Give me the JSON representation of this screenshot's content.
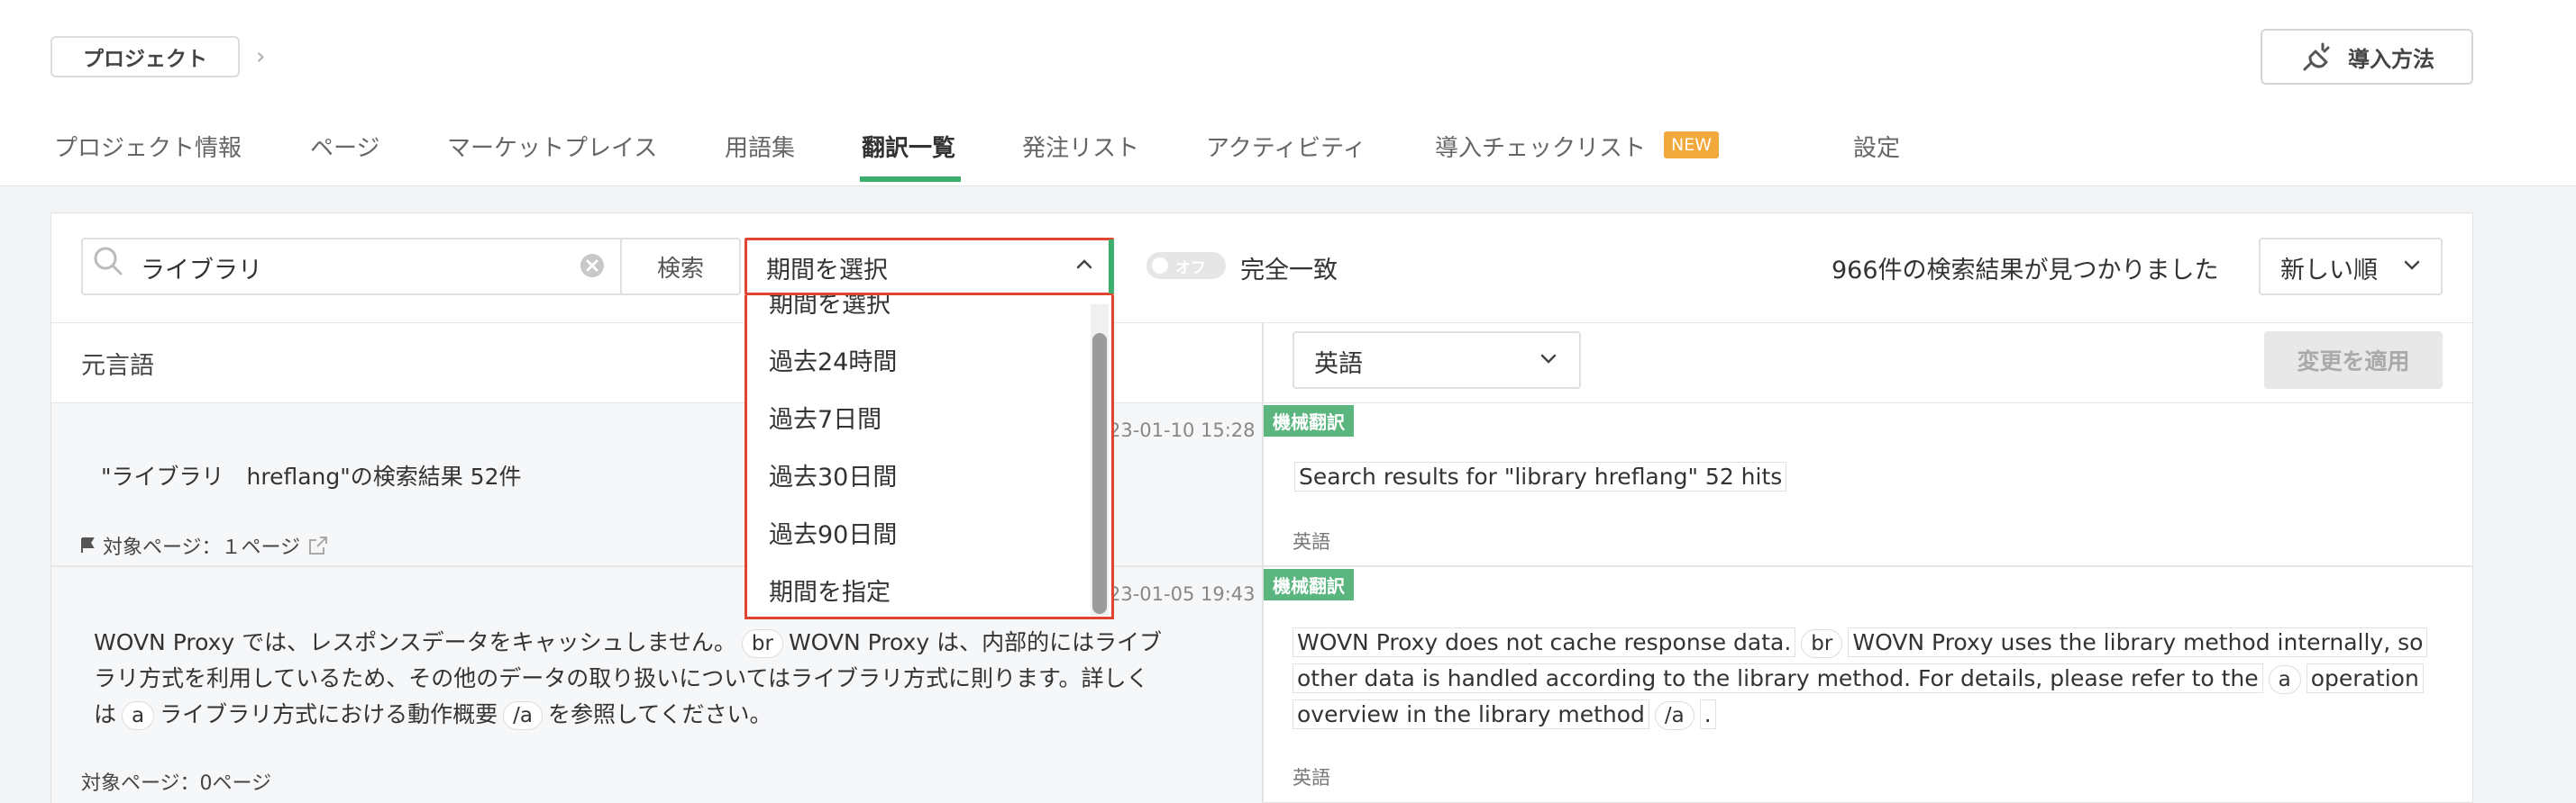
{
  "header": {
    "breadcrumb_label": "プロジェクト",
    "install_label": "導入方法"
  },
  "tabs": [
    {
      "label": "プロジェクト情報"
    },
    {
      "label": "ページ"
    },
    {
      "label": "マーケットプレイス"
    },
    {
      "label": "用語集"
    },
    {
      "label": "翻訳一覧",
      "active": true
    },
    {
      "label": "発注リスト"
    },
    {
      "label": "アクティビティ"
    },
    {
      "label": "導入チェックリスト",
      "badge": "NEW"
    },
    {
      "label": "設定"
    }
  ],
  "search": {
    "query": "ライブラリ",
    "button_label": "検索"
  },
  "period": {
    "selected": "期間を選択",
    "options": [
      "期間を選択",
      "過去24時間",
      "過去7日間",
      "過去30日間",
      "過去90日間",
      "期間を指定"
    ]
  },
  "toggle": {
    "state_label": "オフ",
    "label": "完全一致"
  },
  "results": {
    "count_text": "966件の検索結果が見つかりました"
  },
  "sort": {
    "selected": "新しい順"
  },
  "columns": {
    "source_label": "元言語",
    "target_language": "英語",
    "apply_label": "変更を適用"
  },
  "rows": [
    {
      "timestamp_partial": "23-01-10 15:28",
      "badge": "機械翻訳",
      "source_text": "\"ライブラリ　hreflang\"の検索結果 52件",
      "target_pages": "対象ページ：１ページ",
      "translation": "Search results for \"library hreflang\" 52 hits",
      "lang": "英語"
    },
    {
      "timestamp_partial": "23-01-05 19:43",
      "badge": "機械翻訳",
      "source_lines": [
        [
          "WOVN Proxy では、レスポンスデータをキャッシュしません。",
          "br",
          "WOVN Proxy は、内部的にはライブ"
        ],
        [
          "ラリ方式を利用しているため、その他のデータの取り扱いについてはライブラリ方式に則ります。詳しく"
        ],
        [
          "は",
          "a",
          "ライブラリ方式における動作概要",
          "/a",
          "を参照してください。"
        ]
      ],
      "target_pages": "対象ページ：0ページ",
      "translation_lines": [
        [
          "WOVN Proxy does not cache response data.",
          "br",
          "WOVN Proxy uses the library method internally, so"
        ],
        [
          "other data is handled according to the library method. For details, please refer to the",
          "a",
          "operation"
        ],
        [
          "overview in the library method",
          "/a",
          "."
        ]
      ],
      "lang": "英語"
    }
  ],
  "colors": {
    "accent_green": "#3cae6e",
    "machine_badge": "#5bb57f",
    "dropdown_border": "#e0452f",
    "new_badge": "#f2a93b"
  }
}
